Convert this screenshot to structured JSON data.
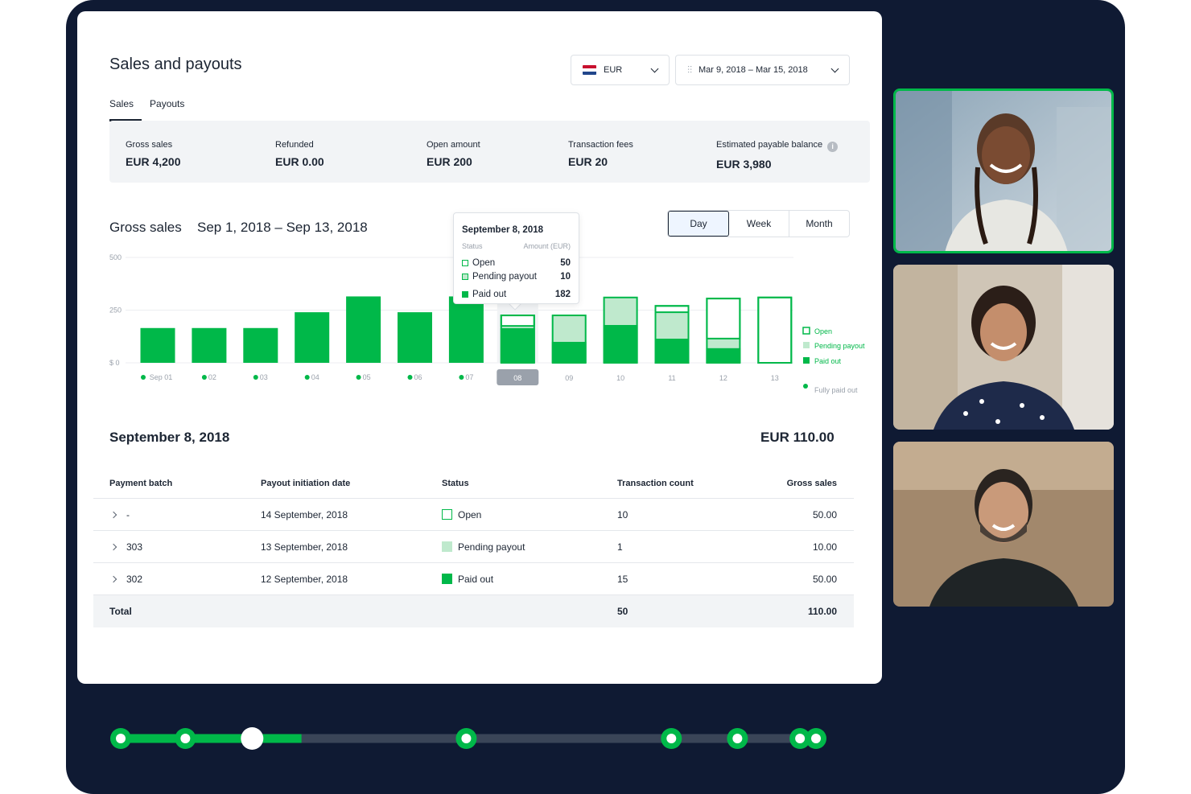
{
  "header": {
    "title": "Sales and payouts",
    "currency": "EUR",
    "date_range": "Mar 9, 2018 – Mar 15, 2018"
  },
  "tabs": [
    {
      "label": "Sales",
      "active": true
    },
    {
      "label": "Payouts",
      "active": false
    }
  ],
  "summary": [
    {
      "label": "Gross sales",
      "value": "EUR 4,200"
    },
    {
      "label": "Refunded",
      "value": "EUR 0.00"
    },
    {
      "label": "Open amount",
      "value": "EUR 200"
    },
    {
      "label": "Transaction fees",
      "value": "EUR 20"
    },
    {
      "label": "Estimated payable balance",
      "value": "EUR 3,980"
    }
  ],
  "chart_header": {
    "title": "Gross sales",
    "range": "Sep 1, 2018 – Sep 13, 2018"
  },
  "granularity": {
    "options": [
      "Day",
      "Week",
      "Month"
    ],
    "selected": "Day"
  },
  "tooltip": {
    "date": "September 8, 2018",
    "col_status": "Status",
    "col_amount": "Amount (EUR)",
    "rows": [
      {
        "label": "Open",
        "amount": "50"
      },
      {
        "label": "Pending payout",
        "amount": "10"
      },
      {
        "label": "Paid out",
        "amount": "182"
      }
    ]
  },
  "chart_data": {
    "type": "bar",
    "stacked": true,
    "y_ticks": [
      "500",
      "250",
      "$ 0"
    ],
    "ylim": [
      0,
      500
    ],
    "categories": [
      "Sep 01",
      "02",
      "03",
      "04",
      "05",
      "06",
      "07",
      "08",
      "09",
      "10",
      "11",
      "12",
      "13"
    ],
    "fully_paid_out": [
      true,
      true,
      true,
      true,
      true,
      true,
      true,
      false,
      false,
      false,
      false,
      false,
      false
    ],
    "selected_category": "08",
    "series": [
      {
        "name": "Paid out",
        "values": [
          165,
          165,
          165,
          240,
          315,
          240,
          315,
          165,
          100,
          180,
          115,
          70,
          0
        ]
      },
      {
        "name": "Pending payout",
        "values": [
          0,
          0,
          0,
          0,
          0,
          0,
          0,
          10,
          125,
          130,
          125,
          45,
          0
        ]
      },
      {
        "name": "Open",
        "values": [
          0,
          0,
          0,
          0,
          0,
          0,
          0,
          50,
          0,
          0,
          30,
          190,
          310
        ]
      }
    ],
    "legend": [
      "Open",
      "Pending payout",
      "Paid out",
      "Fully paid out"
    ],
    "legend_position": "right",
    "colors": {
      "paid": "#00b849",
      "pending": "#bfe9cd",
      "open_border": "#00b849"
    }
  },
  "detail": {
    "date": "September 8, 2018",
    "total": "EUR 110.00"
  },
  "table": {
    "headers": [
      "Payment batch",
      "Payout initiation date",
      "Status",
      "Transaction count",
      "Gross sales"
    ],
    "rows": [
      {
        "batch": "-",
        "date": "14 September, 2018",
        "status": "Open",
        "count": "10",
        "gross": "50.00"
      },
      {
        "batch": "303",
        "date": "13 September, 2018",
        "status": "Pending payout",
        "count": "1",
        "gross": "10.00"
      },
      {
        "batch": "302",
        "date": "12 September, 2018",
        "status": "Paid out",
        "count": "15",
        "gross": "50.00"
      }
    ],
    "total": {
      "label": "Total",
      "count": "50",
      "gross": "110.00"
    }
  },
  "participants": [
    {
      "name": "participant-1",
      "speaking": true
    },
    {
      "name": "participant-2",
      "speaking": false
    },
    {
      "name": "participant-3",
      "speaking": false
    }
  ],
  "timeline": {
    "progress": 0.26,
    "current_marker": 2,
    "marker_count": 8
  },
  "colors": {
    "background": "#0f1a33",
    "accent": "#00b849",
    "pending": "#bfe9cd",
    "text": "#1c2533"
  }
}
